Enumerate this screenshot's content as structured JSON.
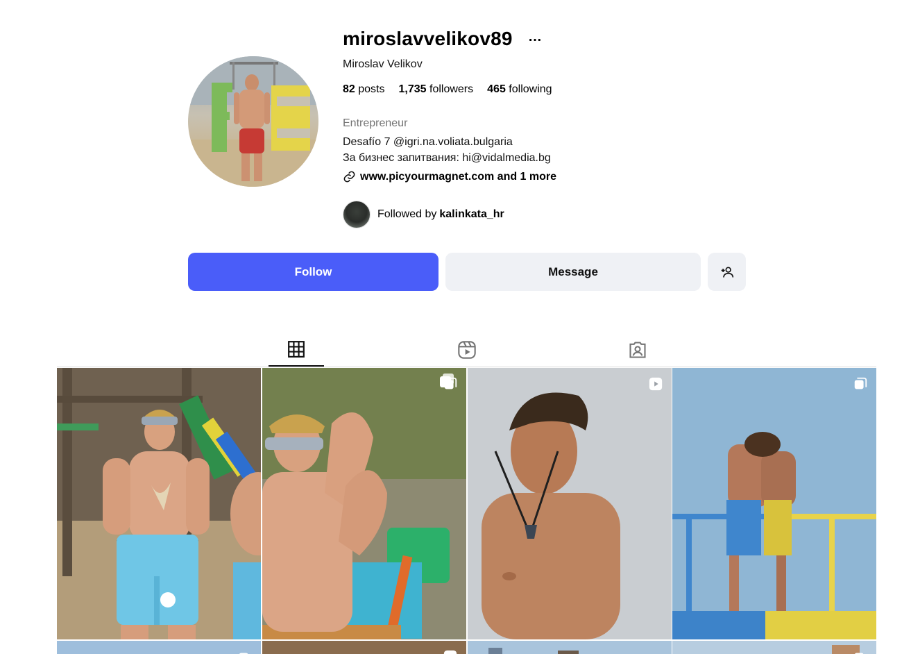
{
  "profile": {
    "username": "miroslavvelikov89",
    "full_name": "Miroslav Velikov",
    "more_icon": "…",
    "stats": {
      "posts_count": "82",
      "posts_label": "posts",
      "followers_count": "1,735",
      "followers_label": "followers",
      "following_count": "465",
      "following_label": "following"
    },
    "category": "Entrepreneur",
    "bio_line1": "Desafío 7 @igri.na.voliata.bulgaria",
    "bio_line2": "За бизнес запитвания: hi@vidalmedia.bg",
    "link_text": "www.picyourmagnet.com and 1 more",
    "followed_by_prefix": "Followed by",
    "followed_by_user": "kalinkata_hr"
  },
  "actions": {
    "follow_label": "Follow",
    "message_label": "Message",
    "suggest_icon": "person-plus-icon"
  },
  "tabs": [
    {
      "name": "posts",
      "icon": "grid-icon",
      "active": true
    },
    {
      "name": "reels",
      "icon": "reels-icon",
      "active": false
    },
    {
      "name": "tagged",
      "icon": "tagged-icon",
      "active": false
    }
  ],
  "posts": [
    {
      "type": "photo",
      "badge": ""
    },
    {
      "type": "carousel",
      "badge": "carousel-icon"
    },
    {
      "type": "reel",
      "badge": "reel-icon"
    },
    {
      "type": "carousel",
      "badge": "carousel-icon"
    },
    {
      "type": "carousel",
      "badge": "carousel-icon"
    },
    {
      "type": "reel",
      "badge": "reel-icon"
    },
    {
      "type": "photo",
      "badge": ""
    },
    {
      "type": "carousel",
      "badge": "carousel-icon"
    }
  ],
  "colors": {
    "follow_button": "#4a5df9",
    "secondary_button": "#eff1f5",
    "muted_text": "#737373"
  }
}
